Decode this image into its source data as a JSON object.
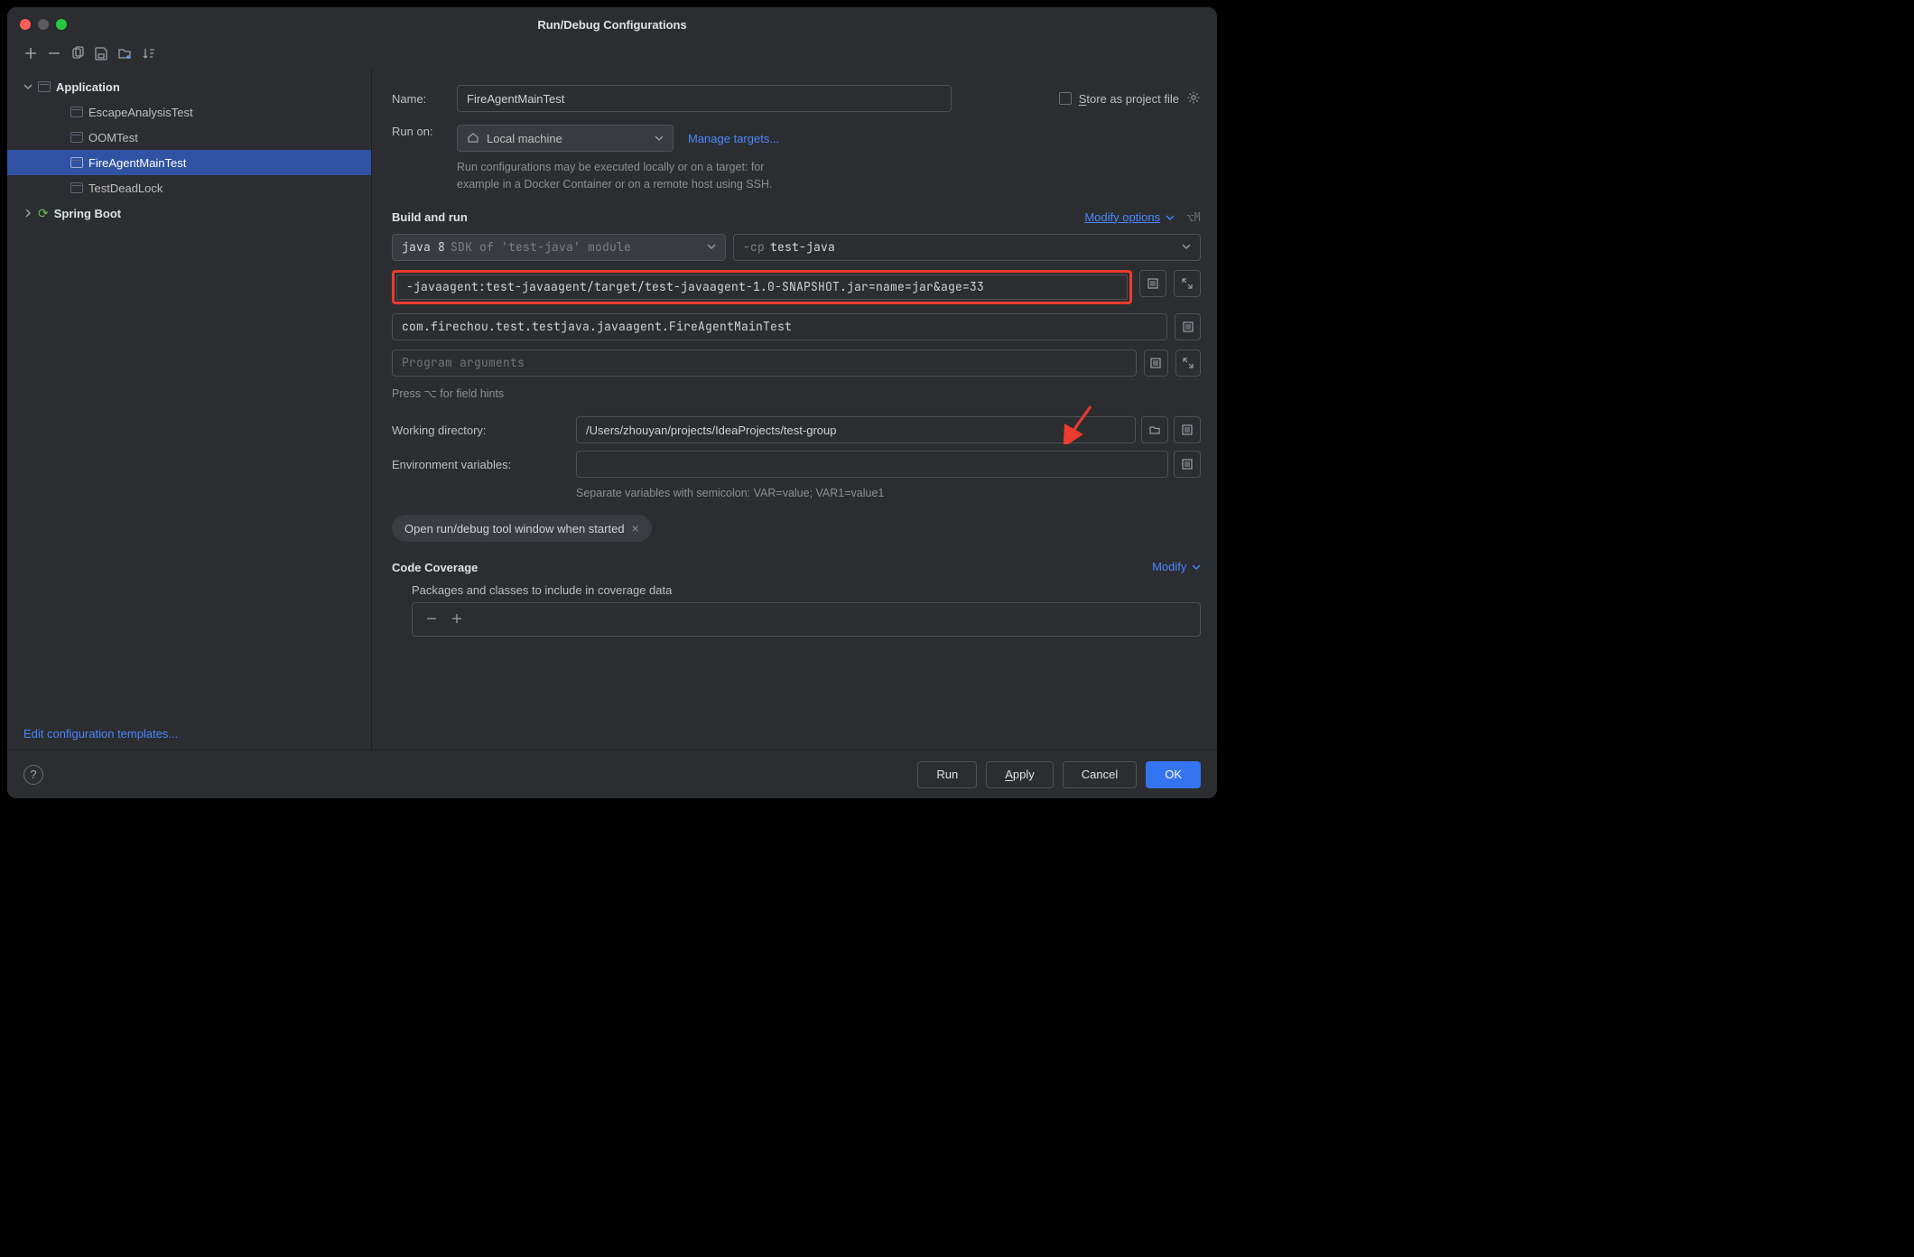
{
  "window": {
    "title": "Run/Debug Configurations"
  },
  "sidebar": {
    "groups": [
      {
        "name": "Application",
        "expanded": true,
        "items": [
          {
            "label": "EscapeAnalysisTest",
            "selected": false
          },
          {
            "label": "OOMTest",
            "selected": false
          },
          {
            "label": "FireAgentMainTest",
            "selected": true
          },
          {
            "label": "TestDeadLock",
            "selected": false
          }
        ]
      },
      {
        "name": "Spring Boot",
        "expanded": false,
        "items": []
      }
    ],
    "edit_templates": "Edit configuration templates..."
  },
  "form": {
    "name_label": "Name:",
    "name_value": "FireAgentMainTest",
    "store_label": "Store as project file",
    "runon_label": "Run on:",
    "runon_value": "Local machine",
    "manage_targets": "Manage targets...",
    "runon_hint1": "Run configurations may be executed locally or on a target: for",
    "runon_hint2": "example in a Docker Container or on a remote host using SSH.",
    "build_run_title": "Build and run",
    "modify_options": "Modify options",
    "modify_shortcut": "⌥M",
    "sdk_value": "java 8",
    "sdk_hint": "SDK of 'test-java' module",
    "cp_flag": "-cp",
    "cp_value": "test-java",
    "vm_options": "-javaagent:test-javaagent/target/test-javaagent-1.0-SNAPSHOT.jar=name=jar&age=33",
    "main_class": "com.firechou.test.testjava.javaagent.FireAgentMainTest",
    "program_args_placeholder": "Program arguments",
    "hint_alt": "Press ⌥ for field hints",
    "wd_label": "Working directory:",
    "wd_value": "/Users/zhouyan/projects/IdeaProjects/test-group",
    "env_label": "Environment variables:",
    "env_hint": "Separate variables with semicolon: VAR=value; VAR1=value1",
    "chip_open": "Open run/debug tool window when started",
    "coverage_title": "Code Coverage",
    "coverage_modify": "Modify",
    "coverage_sub": "Packages and classes to include in coverage data"
  },
  "footer": {
    "run": "Run",
    "apply": "Apply",
    "cancel": "Cancel",
    "ok": "OK"
  }
}
